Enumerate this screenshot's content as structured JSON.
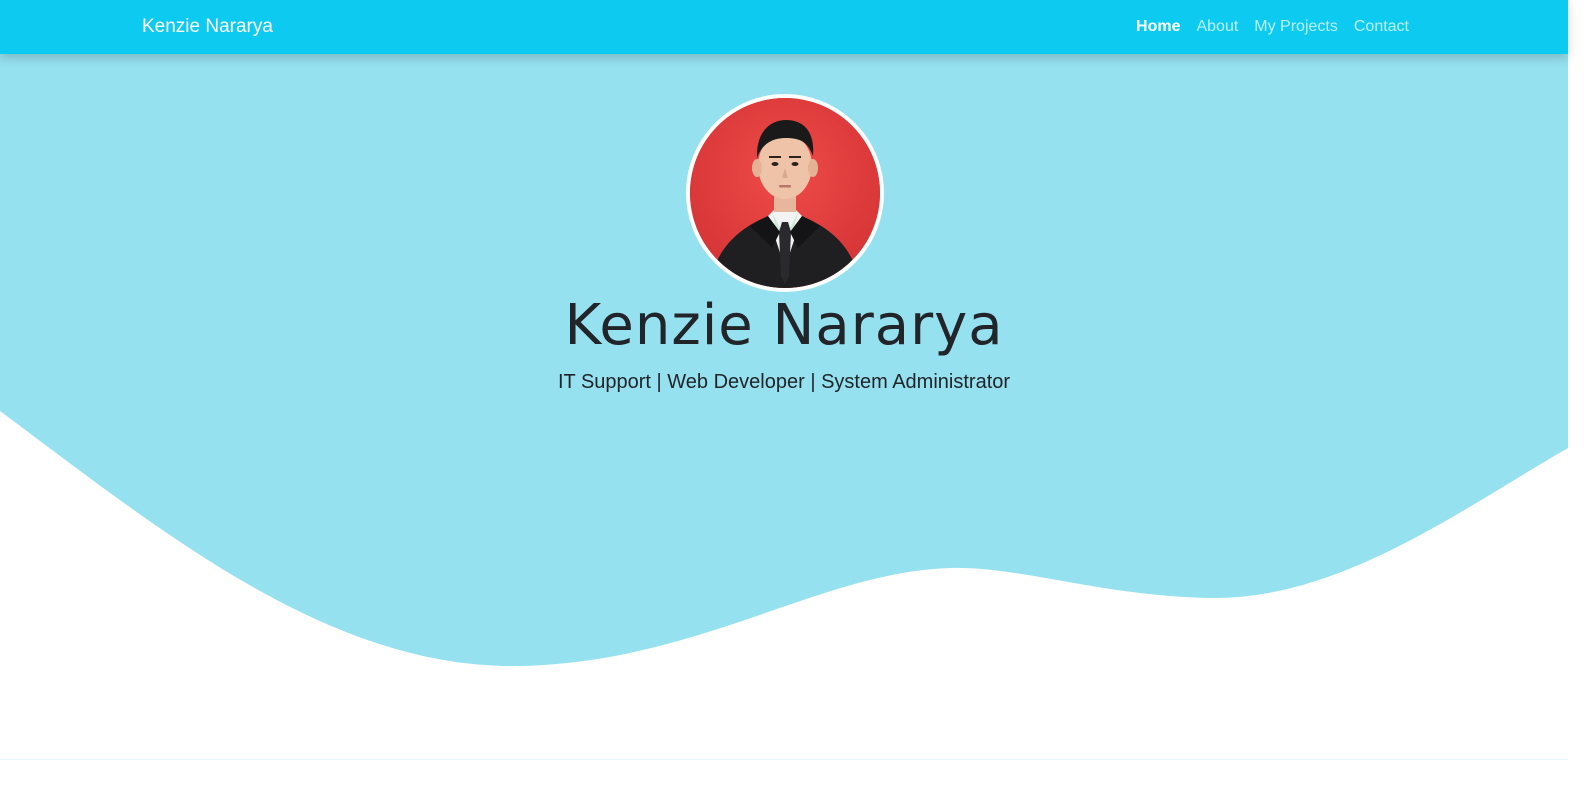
{
  "navbar": {
    "brand": "Kenzie Nararya",
    "items": [
      {
        "label": "Home",
        "active": true
      },
      {
        "label": "About",
        "active": false
      },
      {
        "label": "My Projects",
        "active": false
      },
      {
        "label": "Contact",
        "active": false
      }
    ]
  },
  "hero": {
    "title": "Kenzie Nararya",
    "subtitle": "IT Support | Web Developer | System Administrator"
  },
  "colors": {
    "navbar": "#0dcaf0",
    "hero_background": "#96e1f0",
    "avatar_background": "#e43a3a",
    "text": "#212529"
  }
}
